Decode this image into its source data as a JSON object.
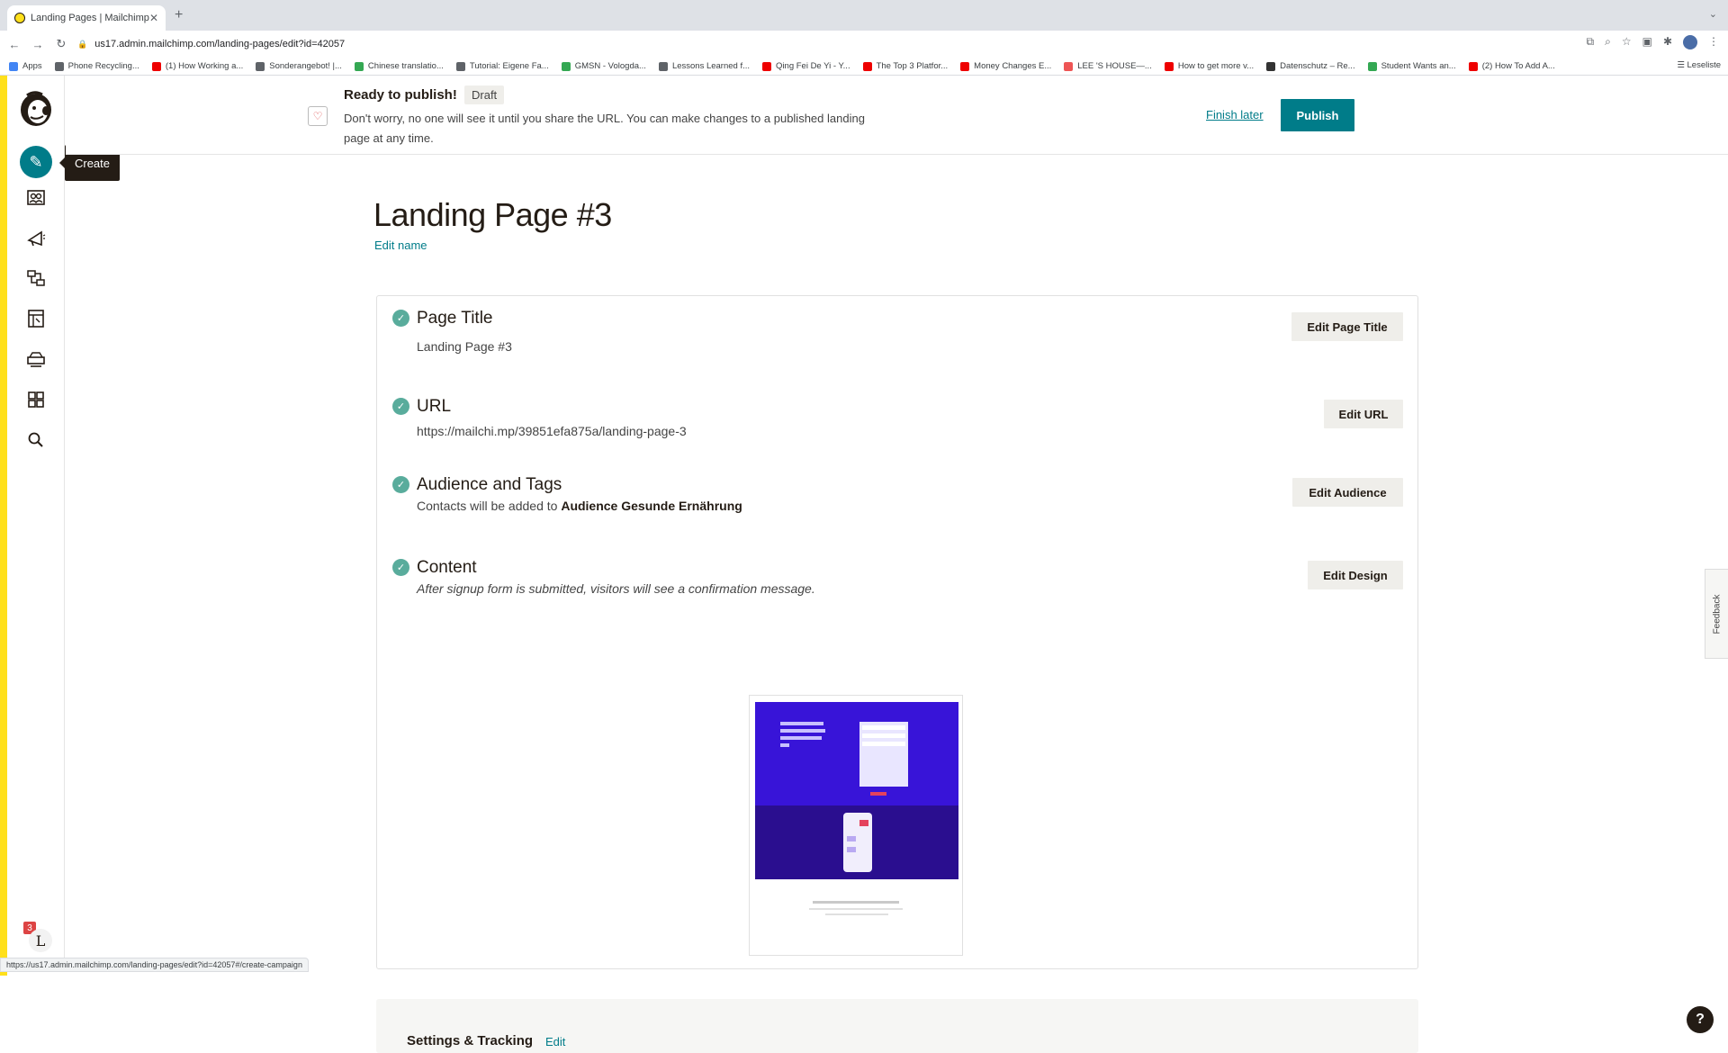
{
  "browser": {
    "tab_title": "Landing Pages | Mailchimp",
    "url": "us17.admin.mailchimp.com/landing-pages/edit?id=42057",
    "bookmarks": [
      {
        "label": "Apps",
        "color": "#4285f4"
      },
      {
        "label": "Phone Recycling...",
        "color": "#5f6368"
      },
      {
        "label": "(1) How Working a...",
        "color": "#e00"
      },
      {
        "label": "Sonderangebot! |...",
        "color": "#5f6368"
      },
      {
        "label": "Chinese translatio...",
        "color": "#34a853"
      },
      {
        "label": "Tutorial: Eigene Fa...",
        "color": "#5f6368"
      },
      {
        "label": "GMSN - Vologda...",
        "color": "#34a853"
      },
      {
        "label": "Lessons Learned f...",
        "color": "#5f6368"
      },
      {
        "label": "Qing Fei De Yi - Y...",
        "color": "#e00"
      },
      {
        "label": "The Top 3 Platfor...",
        "color": "#e00"
      },
      {
        "label": "Money Changes E...",
        "color": "#e00"
      },
      {
        "label": "LEE 'S HOUSE—...",
        "color": "#e55"
      },
      {
        "label": "How to get more v...",
        "color": "#e00"
      },
      {
        "label": "Datenschutz – Re...",
        "color": "#333"
      },
      {
        "label": "Student Wants an...",
        "color": "#34a853"
      },
      {
        "label": "(2) How To Add A...",
        "color": "#e00"
      }
    ],
    "reading_list": "Leseliste",
    "status_url": "https://us17.admin.mailchimp.com/landing-pages/edit?id=42057#/create-campaign"
  },
  "sidebar": {
    "tooltip": "Create",
    "notification_count": "3",
    "avatar_initial": "L",
    "icons": [
      "audience-icon",
      "campaigns-icon",
      "automations-icon",
      "website-icon",
      "content-icon",
      "integrations-icon",
      "search-icon"
    ]
  },
  "banner": {
    "title": "Ready to publish!",
    "badge": "Draft",
    "text": "Don't worry, no one will see it until you share the URL. You can make changes to a published landing page at any time.",
    "finish_later": "Finish later",
    "publish": "Publish"
  },
  "page": {
    "title": "Landing Page #3",
    "edit_name": "Edit name"
  },
  "checklist": {
    "page_title": {
      "heading": "Page Title",
      "value": "Landing Page #3",
      "button": "Edit Page Title"
    },
    "url": {
      "heading": "URL",
      "value": "https://mailchi.mp/39851efa875a/landing-page-3",
      "button": "Edit URL"
    },
    "audience": {
      "heading": "Audience and Tags",
      "prefix": "Contacts will be added to ",
      "value": "Audience Gesunde Ernährung",
      "button": "Edit Audience"
    },
    "content": {
      "heading": "Content",
      "value": "After signup form is submitted, visitors will see a confirmation message.",
      "button": "Edit Design"
    }
  },
  "settings": {
    "label": "Settings & Tracking",
    "edit": "Edit"
  },
  "feedback": "Feedback",
  "help": "?",
  "colors": {
    "accent": "#007c89",
    "brand_yellow": "#ffe01b",
    "check": "#59ac9c"
  }
}
